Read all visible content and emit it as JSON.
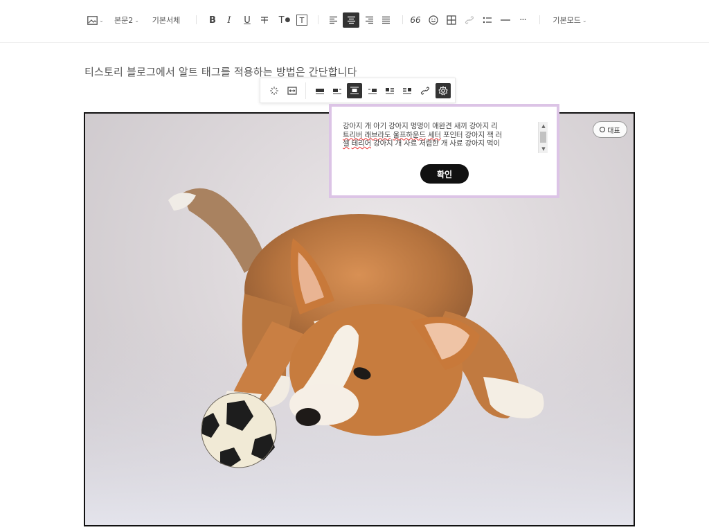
{
  "toolbar": {
    "image_icon": "image-icon",
    "paragraph_style": "본문2",
    "font": "기본서체",
    "bold": "B",
    "italic": "I",
    "underline": "U",
    "strike": "ㅜ",
    "text_color": "T",
    "text_bg": "T",
    "quote": "66",
    "more": "···",
    "mode": "기본모드"
  },
  "content": {
    "paragraph": "티스토리 블로그에서 알트 태그를 적용하는 방법은 간단합니다"
  },
  "image": {
    "representative_label": "대표"
  },
  "alt_popup": {
    "alt_text_line1": "강아지 개 아기 강아지 멍멍이 애완견 새끼 강아지 리",
    "alt_text_line2_a": "트리버 래브라도",
    "alt_text_line2_b": "울프하운드",
    "alt_text_line2_c": "세터",
    "alt_text_line2_d": "포인터",
    "alt_text_line2_e": "강아지 잭 러",
    "alt_text_line3_a": "셀",
    "alt_text_line3_b": "테리어",
    "alt_text_line3_c": "강아지 개 사료 저렴한 개 사료 강아지 먹이",
    "confirm_label": "확인"
  },
  "colors": {
    "accent_dark": "#333333",
    "popup_border": "#dcc4e6"
  }
}
